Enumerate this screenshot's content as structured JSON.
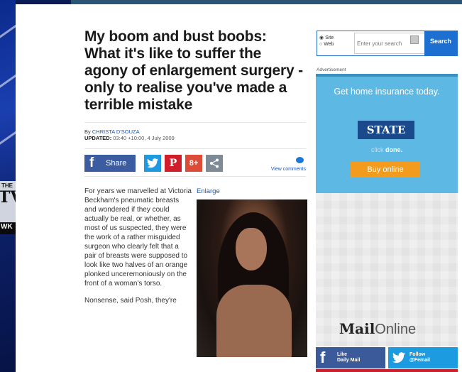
{
  "tv_overlay": {
    "top": "THE",
    "logo": "TV",
    "tag": "WK"
  },
  "article": {
    "headline": "My boom and bust boobs: What it's like to suffer the agony of enlargement surgery - only to realise you've made a terrible mistake",
    "byline_prefix": "By",
    "author": "CHRISTA D'SOUZA",
    "updated_label": "UPDATED:",
    "updated_value": "03:40 +10:00, 4 July 2009",
    "share_label": "Share",
    "view_comments": "View comments",
    "paragraphs": [
      "For years we marvelled at Victoria Beckham's pneumatic breasts and wondered if they could actually be real, or whether, as most of us suspected, they were the work of a rather misguided surgeon who clearly felt that a pair of breasts were supposed to look like two halves of an orange plonked unceremoniously on the front of a woman's torso.",
      "Nonsense, said Posh, they're"
    ],
    "enlarge": "Enlarge"
  },
  "search": {
    "option_site": "Site",
    "option_web": "Web",
    "placeholder": "Enter your search",
    "button": "Search"
  },
  "ad": {
    "label": "Advertisement",
    "headline": "Get home insurance today.",
    "brand": "STATE",
    "click_prefix": "click ",
    "click_bold": "done.",
    "cta": "Buy online"
  },
  "brand": {
    "mail": "Mail",
    "online": "Online"
  },
  "social": {
    "facebook_line1": "Like",
    "facebook_line2": "Daily Mail",
    "twitter_line1": "Follow",
    "twitter_line2": "@Femail"
  },
  "colors": {
    "link": "#1a57b8",
    "facebook": "#3b5ca0",
    "twitter": "#1f9ae2",
    "ad_background": "#5db8e4",
    "ad_cta": "#f39b1c"
  }
}
